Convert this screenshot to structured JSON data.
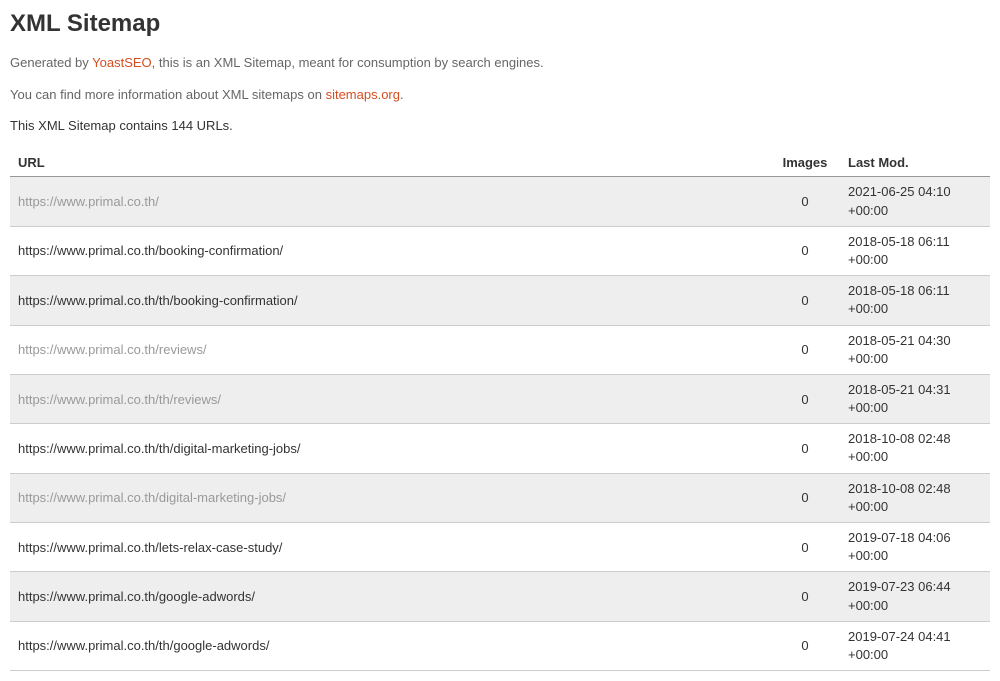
{
  "title": "XML Sitemap",
  "description1_pre": "Generated by ",
  "description1_link": "YoastSEO",
  "description1_post": ", this is an XML Sitemap, meant for consumption by search engines.",
  "description2_pre": "You can find more information about XML sitemaps on ",
  "description2_link": "sitemaps.org",
  "description2_post": ".",
  "url_count_text": "This XML Sitemap contains 144 URLs.",
  "headers": {
    "url": "URL",
    "images": "Images",
    "lastmod": "Last Mod."
  },
  "rows": [
    {
      "url": "https://www.primal.co.th/",
      "muted": true,
      "images": "0",
      "lastmod": "2021-06-25 04:10 +00:00"
    },
    {
      "url": "https://www.primal.co.th/booking-confirmation/",
      "muted": false,
      "images": "0",
      "lastmod": "2018-05-18 06:11 +00:00"
    },
    {
      "url": "https://www.primal.co.th/th/booking-confirmation/",
      "muted": false,
      "images": "0",
      "lastmod": "2018-05-18 06:11 +00:00"
    },
    {
      "url": "https://www.primal.co.th/reviews/",
      "muted": true,
      "images": "0",
      "lastmod": "2018-05-21 04:30 +00:00"
    },
    {
      "url": "https://www.primal.co.th/th/reviews/",
      "muted": true,
      "images": "0",
      "lastmod": "2018-05-21 04:31 +00:00"
    },
    {
      "url": "https://www.primal.co.th/th/digital-marketing-jobs/",
      "muted": false,
      "images": "0",
      "lastmod": "2018-10-08 02:48 +00:00"
    },
    {
      "url": "https://www.primal.co.th/digital-marketing-jobs/",
      "muted": true,
      "images": "0",
      "lastmod": "2018-10-08 02:48 +00:00"
    },
    {
      "url": "https://www.primal.co.th/lets-relax-case-study/",
      "muted": false,
      "images": "0",
      "lastmod": "2019-07-18 04:06 +00:00"
    },
    {
      "url": "https://www.primal.co.th/google-adwords/",
      "muted": false,
      "images": "0",
      "lastmod": "2019-07-23 06:44 +00:00"
    },
    {
      "url": "https://www.primal.co.th/th/google-adwords/",
      "muted": false,
      "images": "0",
      "lastmod": "2019-07-24 04:41 +00:00"
    }
  ]
}
